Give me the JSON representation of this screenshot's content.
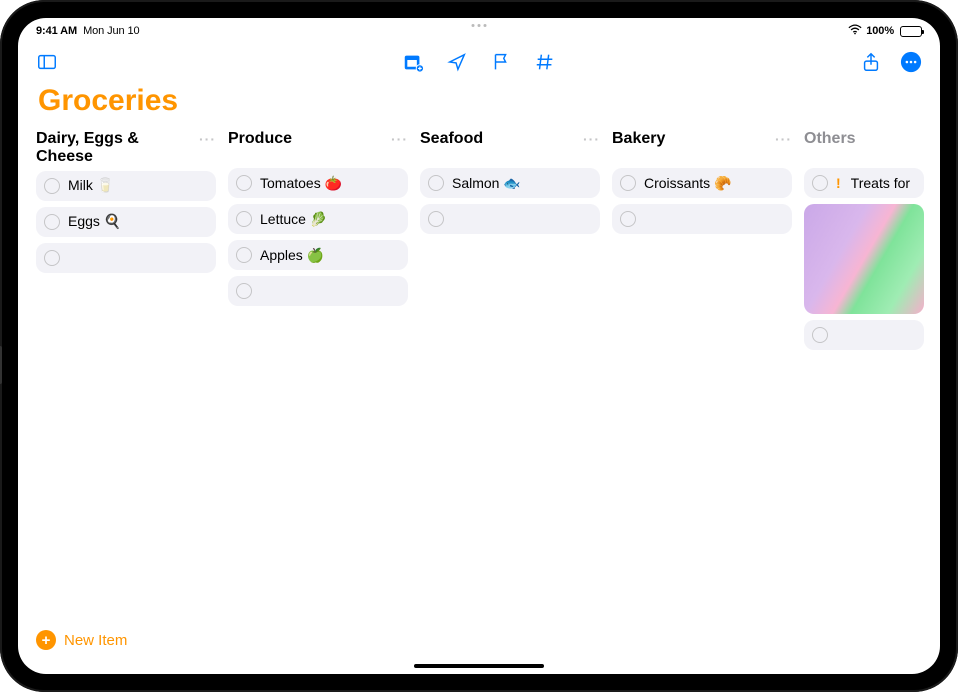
{
  "status": {
    "time": "9:41 AM",
    "date": "Mon Jun 10",
    "battery_pct": "100%"
  },
  "list": {
    "title": "Groceries",
    "new_item_label": "New Item"
  },
  "columns": [
    {
      "title": "Dairy, Eggs & Cheese",
      "items": [
        {
          "label": "Milk 🥛"
        },
        {
          "label": "Eggs 🍳"
        }
      ],
      "extra_empty": 1
    },
    {
      "title": "Produce",
      "items": [
        {
          "label": "Tomatoes 🍅"
        },
        {
          "label": "Lettuce 🥬"
        },
        {
          "label": "Apples 🍏"
        }
      ],
      "extra_empty": 1
    },
    {
      "title": "Seafood",
      "items": [
        {
          "label": "Salmon 🐟"
        }
      ],
      "extra_empty": 1
    },
    {
      "title": "Bakery",
      "items": [
        {
          "label": "Croissants 🥐"
        }
      ],
      "extra_empty": 1
    },
    {
      "title": "Others",
      "others": true,
      "items": [
        {
          "label": "Treats for",
          "priority": true
        },
        {
          "image": true
        }
      ],
      "extra_empty": 1
    }
  ]
}
